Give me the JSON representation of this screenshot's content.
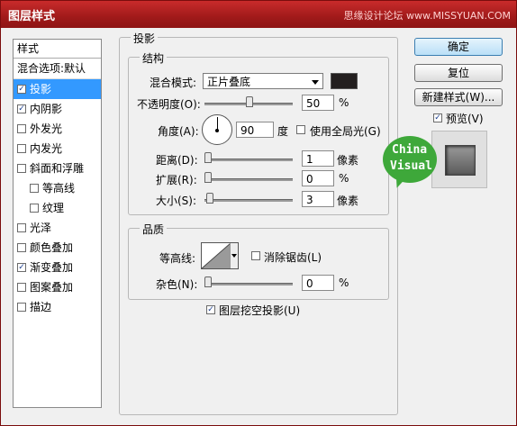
{
  "window": {
    "title": "图层样式",
    "watermark": "思缘设计论坛 www.MISSYUAN.COM"
  },
  "styles_panel": {
    "header": "样式",
    "items": [
      {
        "label": "混合选项:默认",
        "checkbox": false,
        "checked": false,
        "indent": false,
        "selected": false
      },
      {
        "label": "投影",
        "checkbox": true,
        "checked": true,
        "indent": false,
        "selected": true
      },
      {
        "label": "内阴影",
        "checkbox": true,
        "checked": true,
        "indent": false,
        "selected": false
      },
      {
        "label": "外发光",
        "checkbox": true,
        "checked": false,
        "indent": false,
        "selected": false
      },
      {
        "label": "内发光",
        "checkbox": true,
        "checked": false,
        "indent": false,
        "selected": false
      },
      {
        "label": "斜面和浮雕",
        "checkbox": true,
        "checked": false,
        "indent": false,
        "selected": false
      },
      {
        "label": "等高线",
        "checkbox": true,
        "checked": false,
        "indent": true,
        "selected": false
      },
      {
        "label": "纹理",
        "checkbox": true,
        "checked": false,
        "indent": true,
        "selected": false
      },
      {
        "label": "光泽",
        "checkbox": true,
        "checked": false,
        "indent": false,
        "selected": false
      },
      {
        "label": "颜色叠加",
        "checkbox": true,
        "checked": false,
        "indent": false,
        "selected": false
      },
      {
        "label": "渐变叠加",
        "checkbox": true,
        "checked": true,
        "indent": false,
        "selected": false
      },
      {
        "label": "图案叠加",
        "checkbox": true,
        "checked": false,
        "indent": false,
        "selected": false
      },
      {
        "label": "描边",
        "checkbox": true,
        "checked": false,
        "indent": false,
        "selected": false
      }
    ]
  },
  "drop_shadow": {
    "section_title": "投影",
    "structure": {
      "title": "结构",
      "blend_mode_label": "混合模式:",
      "blend_mode_value": "正片叠底",
      "shadow_color": "#231f1f",
      "opacity_label": "不透明度(O):",
      "opacity_value": "50",
      "opacity_unit": "%",
      "opacity_level": 0.5,
      "angle_label": "角度(A):",
      "angle_value": "90",
      "angle_unit": "度",
      "global_light_label": "使用全局光(G)",
      "global_light_checked": false,
      "distance_label": "距离(D):",
      "distance_value": "1",
      "distance_unit": "像素",
      "distance_level": 0.0,
      "spread_label": "扩展(R):",
      "spread_value": "0",
      "spread_unit": "%",
      "spread_level": 0.0,
      "size_label": "大小(S):",
      "size_value": "3",
      "size_unit": "像素",
      "size_level": 0.02
    },
    "quality": {
      "title": "品质",
      "contour_label": "等高线:",
      "anti_alias_label": "消除锯齿(L)",
      "anti_alias_checked": false,
      "noise_label": "杂色(N):",
      "noise_value": "0",
      "noise_unit": "%",
      "noise_level": 0.0
    },
    "knockout_label": "图层挖空投影(U)",
    "knockout_checked": true
  },
  "buttons": {
    "ok": "确定",
    "reset": "复位",
    "new_style": "新建样式(W)..."
  },
  "preview": {
    "label": "预览(V)",
    "checked": true
  },
  "badge": {
    "line1": "China",
    "line2": "Visual",
    "color": "#3ea83a"
  },
  "colors": {
    "titlebar": "#a01a1a",
    "selection": "#3399ff"
  }
}
